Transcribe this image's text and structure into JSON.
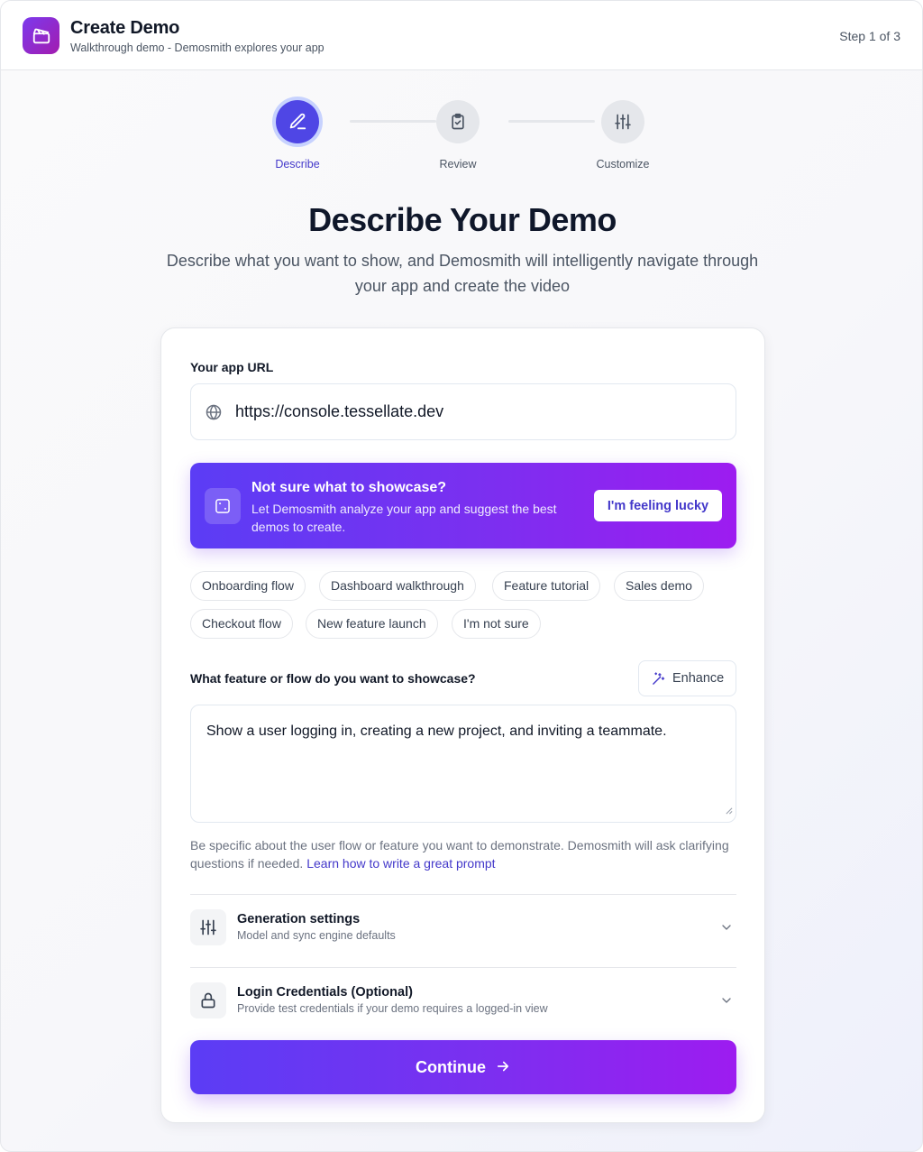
{
  "header": {
    "app_icon": "clapperboard-icon",
    "title": "Create Demo",
    "subtitle": "Walkthrough demo - Demosmith explores your app",
    "step_indicator": "Step 1 of 3"
  },
  "stepper": {
    "steps": [
      {
        "label": "Describe",
        "icon": "pencil-icon",
        "state": "active"
      },
      {
        "label": "Review",
        "icon": "clipboard-check-icon",
        "state": "pending"
      },
      {
        "label": "Customize",
        "icon": "sliders-icon",
        "state": "pending"
      }
    ]
  },
  "main": {
    "title": "Describe Your Demo",
    "description": "Describe what you want to show, and Demosmith will intelligently navigate through your app and create the video"
  },
  "form": {
    "url_label": "Your app URL",
    "url_icon": "globe-icon",
    "url_value": "https://console.tessellate.dev",
    "lucky": {
      "icon": "dice-icon",
      "title": "Not sure what to showcase?",
      "description": "Let Demosmith analyze your app and suggest the best demos to create.",
      "button_label": "I'm feeling lucky"
    },
    "chips": [
      "Onboarding flow",
      "Dashboard walkthrough",
      "Feature tutorial",
      "Sales demo",
      "Checkout flow",
      "New feature launch",
      "I'm not sure"
    ],
    "feature_label": "What feature or flow do you want to showcase?",
    "enhance_label": "Enhance",
    "enhance_icon": "magic-wand-icon",
    "feature_value": "Show a user logging in, creating a new project, and inviting a teammate.",
    "helper_text": "Be specific about the user flow or feature you want to demonstrate. Demosmith will ask clarifying questions if needed.",
    "helper_link": "Learn how to write a great prompt",
    "accordions": [
      {
        "title": "Generation settings",
        "subtitle": "Model and sync engine defaults",
        "icon": "sliders-icon"
      },
      {
        "title": "Login Credentials (Optional)",
        "subtitle": "Provide test credentials if your demo requires a logged-in view",
        "icon": "lock-icon"
      }
    ],
    "continue_label": "Continue",
    "continue_icon": "arrow-right-icon"
  },
  "colors": {
    "accent": "#4f46e5",
    "gradient_start": "#5b3df5",
    "gradient_end": "#9d1cf0",
    "link": "#4338ca"
  }
}
